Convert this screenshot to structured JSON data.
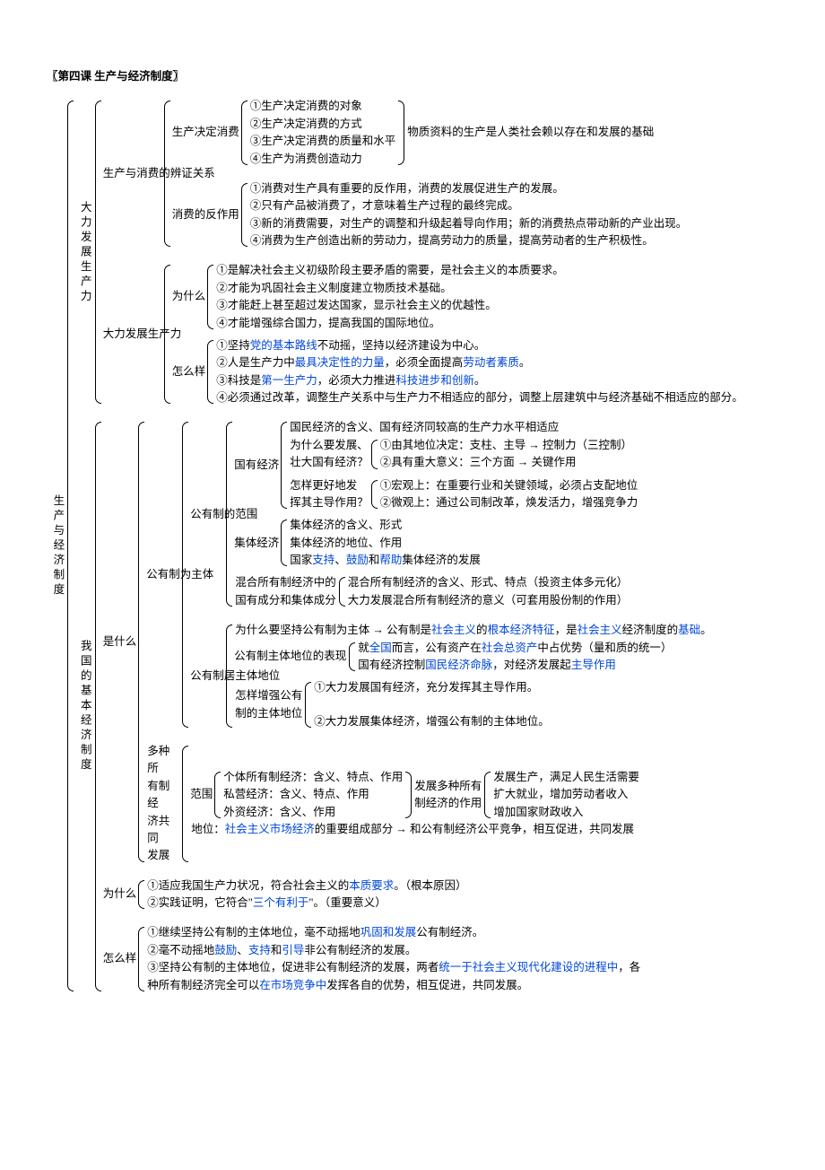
{
  "title": "〖第四课  生产与经济制度〗",
  "root": "生产与经济制度",
  "s1": {
    "label": "大力发展生产力",
    "a": {
      "label": "生产与消费的辨证关系",
      "p1": {
        "label": "生产决定消费",
        "i1": "①生产决定消费的对象",
        "i2": "②生产决定消费的方式",
        "i3": "③生产决定消费的质量和水平",
        "i4": "④生产为消费创造动力",
        "note": "物质资料的生产是人类社会赖以存在和发展的基础"
      },
      "p2": {
        "label": "消费的反作用",
        "i1": "①消费对生产具有重要的反作用，消费的发展促进生产的发展。",
        "i2": "②只有产品被消费了，才意味着生产过程的最终完成。",
        "i3": "③新的消费需要，对生产的调整和升级起着导向作用；新的消费热点带动新的产业出现。",
        "i4": "④消费为生产创造出新的劳动力，提高劳动力的质量，提高劳动者的生产积极性。"
      }
    },
    "b": {
      "label": "大力发展生产力",
      "why": {
        "label": "为什么",
        "i1": "①是解决社会主义初级阶段主要矛盾的需要，是社会主义的本质要求。",
        "i2": "②才能为巩固社会主义制度建立物质技术基础。",
        "i3": "③才能赶上甚至超过发达国家，显示社会主义的优越性。",
        "i4": "④才能增强综合国力，提高我国的国际地位。"
      },
      "how": {
        "label": "怎么样",
        "i1a": "①坚持",
        "i1b": "党的基本路线",
        "i1c": "不动摇，坚持以经济建设为中心。",
        "i2a": "②人是生产力中",
        "i2b": "最具决定性的力量",
        "i2c": "，必须全面提高",
        "i2d": "劳动者素质",
        "i2e": "。",
        "i3a": "③科技是",
        "i3b": "第一生产力",
        "i3c": "，必须大力推进",
        "i3d": "科技进步和创新",
        "i3e": "。",
        "i4": "④必须通过改革，调整生产关系中与生产力不相适应的部分，调整上层建筑中与经济基础不相适应的部分。"
      }
    }
  },
  "s2": {
    "label": "我国的基本经济制度",
    "what": {
      "label": "是什么",
      "pub": {
        "label": "公有制为主体",
        "scope": {
          "label": "公有制的范围",
          "state": {
            "label": "国有经济",
            "i1": "国民经济的含义、国有经济同较高的生产力水平相适应",
            "q1l1": "为什么要发展、",
            "q1l2": "壮大国有经济？",
            "q1a1": "①由其地位决定：支柱、主导 → 控制力（三控制）",
            "q1a2": "②具有重大意义：三个方面 → 关键作用",
            "q2l1": "怎样更好地发",
            "q2l2": "挥其主导作用？",
            "q2a1": "①宏观上：在重要行业和关键领域，必须占支配地位",
            "q2a2": "②微观上：通过公司制改革，焕发活力，增强竞争力"
          },
          "coll": {
            "label": "集体经济",
            "i1": "集体经济的含义、形式",
            "i2": "集体经济的地位、作用",
            "i3a": "国家",
            "i3b": "支持",
            "i3c": "、",
            "i3d": "鼓励",
            "i3e": "和",
            "i3f": "帮助",
            "i3g": "集体经济的发展"
          },
          "mix": {
            "l1": "混合所有制经济中的",
            "l2": "国有成分和集体成分",
            "i1": "混合所有制经济的含义、形式、特点（投资主体多元化）",
            "i2": "大力发展混合所有制经济的意义（可套用股份制的作用）"
          }
        },
        "main": {
          "label": "公有制居主体地位",
          "r1a": "为什么要坚持公有制为主体 → 公有制是",
          "r1b": "社会主义",
          "r1c": "的",
          "r1d": "根本经济特征",
          "r1e": "，是",
          "r1f": "社会主义",
          "r1g": "经济制度的",
          "r1h": "基础",
          "r1i": "。",
          "r2": {
            "label": "公有制主体地位的表现",
            "i1a": "就",
            "i1b": "全国",
            "i1c": "而言，公有资产在",
            "i1d": "社会总资产",
            "i1e": "中占优势（量和质的统一）",
            "i2a": "国有经济控制",
            "i2b": "国民经济命脉",
            "i2c": "，对经济发展起",
            "i2d": "主导作用"
          },
          "r3": {
            "l1": "怎样增强公有",
            "l2": "制的主体地位",
            "i1": "①大力发展国有经济，充分发挥其主导作用。",
            "i2": "②大力发展集体经济，增强公有制的主体地位。"
          }
        }
      },
      "multi": {
        "l1": "多种所",
        "l2": "有制经",
        "l3": "济共同",
        "l4": "发展",
        "scope": {
          "label": "范围",
          "i1": "个体所有制经济：含义、特点、作用",
          "i2": "私营经济：含义、特点、作用",
          "i3": "外资经济：含义、作用",
          "role": {
            "l1": "发展多种所有",
            "l2": "制经济的作用",
            "i1": "发展生产，满足人民生活需要",
            "i2": "扩大就业，增加劳动者收入",
            "i3": "增加国家财政收入"
          }
        },
        "posa": "地位：",
        "posb": "社会主义市场经济",
        "posc": "的重要组成部分 → 和公有制经济公平竞争，相互促进，共同发展"
      }
    },
    "why": {
      "label": "为什么",
      "i1a": "①适应我国生产力状况，符合社会主义的",
      "i1b": "本质要求",
      "i1c": "。（根本原因）",
      "i2a": "②实践证明，它符合\"",
      "i2b": "三个有利于",
      "i2c": "\"。（重要意义）"
    },
    "how": {
      "label": "怎么样",
      "i1a": "①继续坚持公有制的主体地位，毫不动摇地",
      "i1b": "巩固和发展",
      "i1c": "公有制经济。",
      "i2a": "②毫不动摇地",
      "i2b": "鼓励",
      "i2c": "、",
      "i2d": "支持",
      "i2e": "和",
      "i2f": "引导",
      "i2g": "非公有制经济的发展。",
      "i3a": "③坚持公有制的主体地位，促进非公有制经济的发展，两者",
      "i3b": "统一于社会主义现代化建设的进程中",
      "i3c": "，各种所有制经济完全可以",
      "i3d": "在市场竞争中",
      "i3e": "发挥各自的优势，相互促进，共同发展。"
    }
  }
}
